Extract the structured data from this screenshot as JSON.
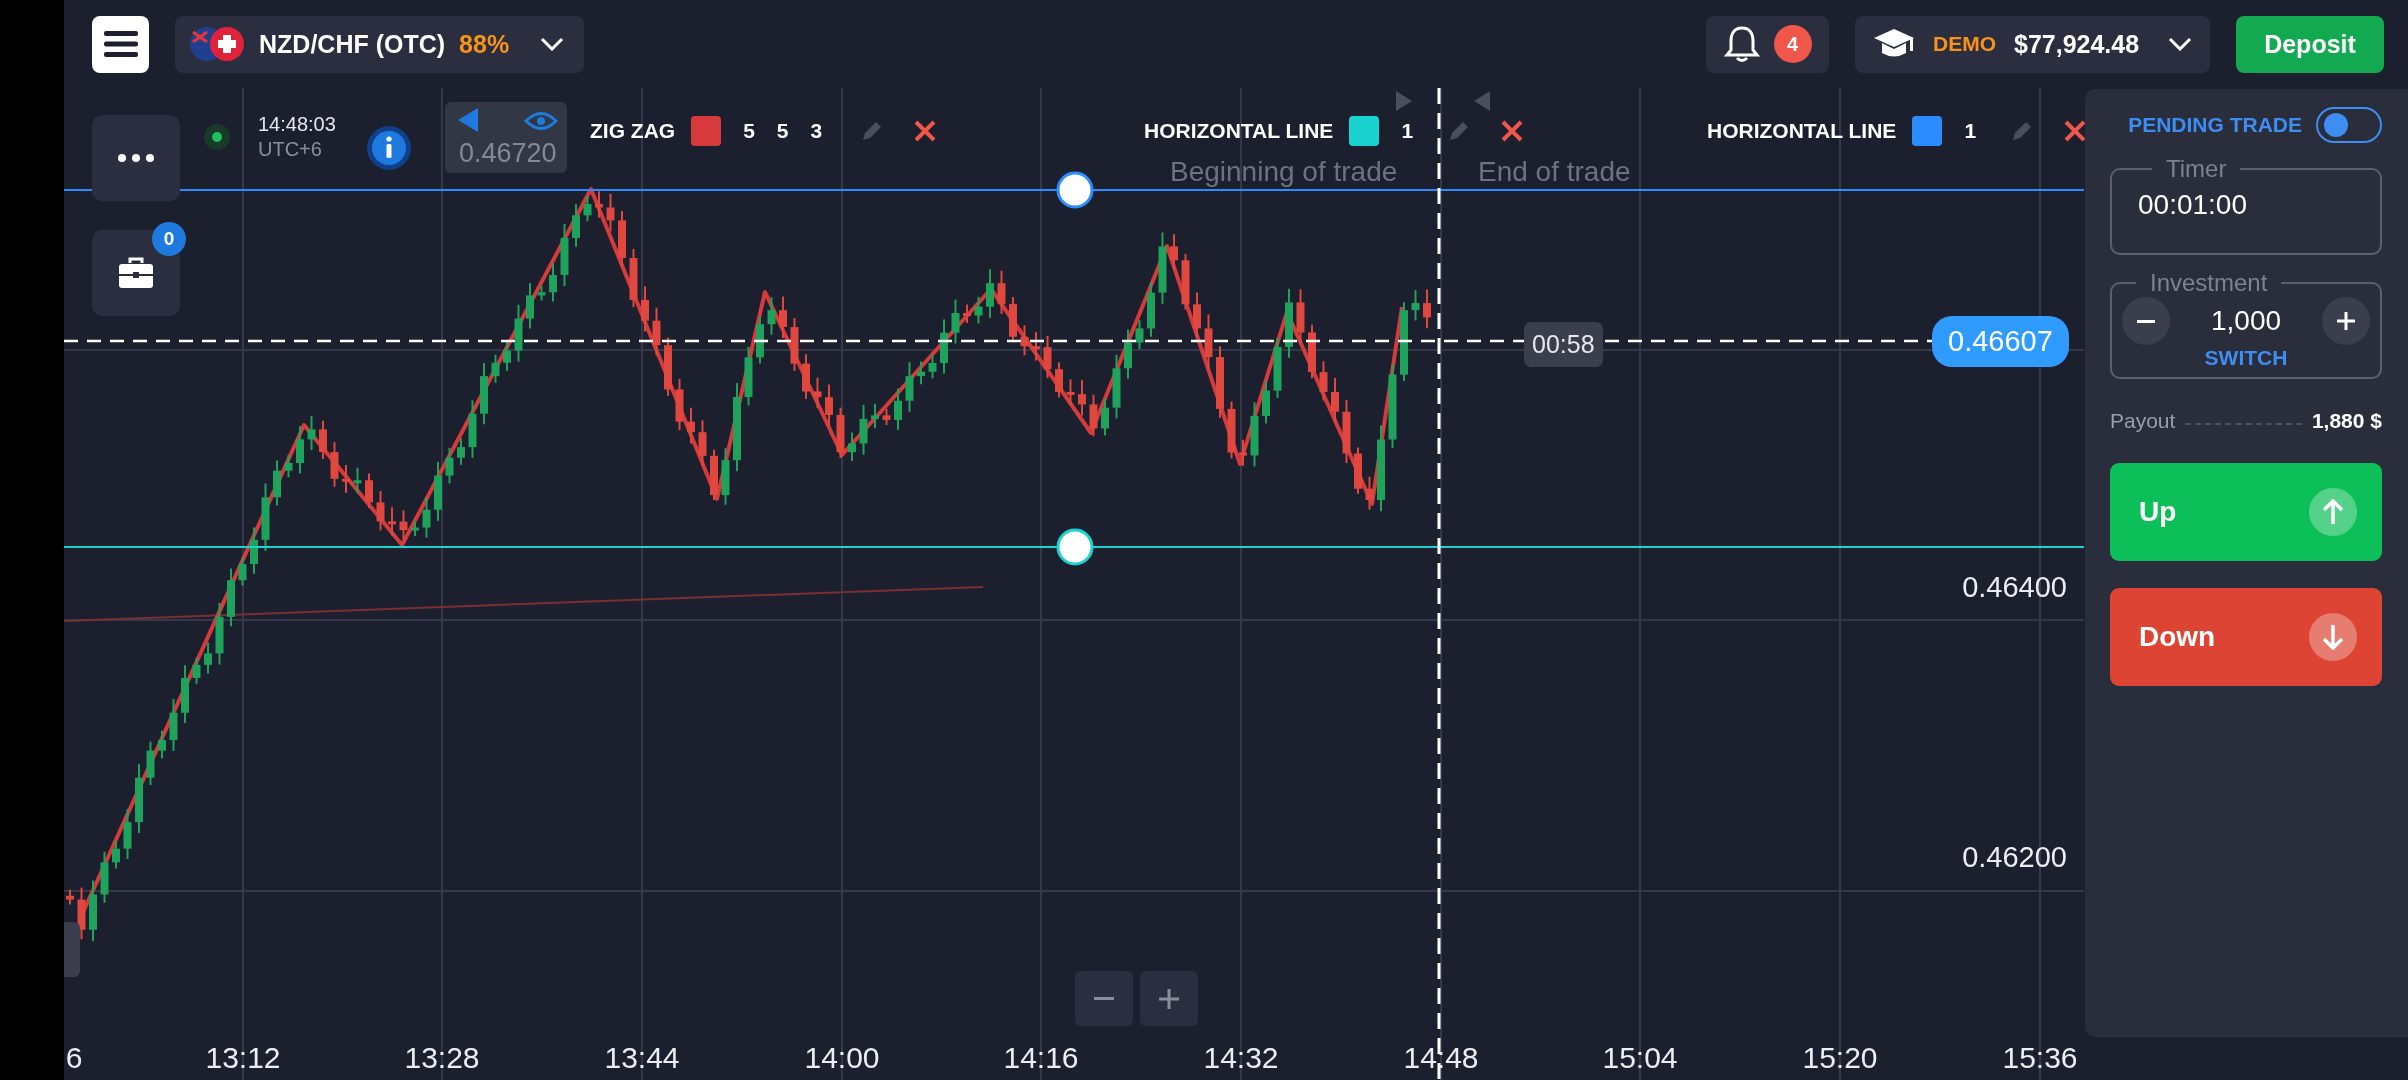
{
  "top_bar": {
    "asset": {
      "name": "NZD/CHF (OTC)",
      "payout": "88%"
    },
    "notifications": {
      "count": "4"
    },
    "account": {
      "type": "DEMO",
      "balance": "$77,924.48"
    },
    "deposit_button": "Deposit"
  },
  "side_buttons": [
    {
      "kind": "more"
    },
    {
      "kind": "portfolio",
      "badge": "0"
    }
  ],
  "chart": {
    "clock": {
      "time": "14:48:03",
      "timezone": "UTC+6"
    },
    "ghost_price": "0.46720",
    "indicators": [
      {
        "kind": "zigzag",
        "name": "ZIG ZAG",
        "color": "#d63a3a",
        "params": [
          "5",
          "5",
          "3"
        ]
      },
      {
        "kind": "hline",
        "name": "HORIZONTAL LINE",
        "color": "#19d3d0",
        "params": [
          "1"
        ]
      },
      {
        "kind": "hline",
        "name": "HORIZONTAL LINE",
        "color": "#2a8cff",
        "params": [
          "1"
        ]
      }
    ],
    "trade_markers": {
      "start": "Beginning of trade",
      "end": "End of trade"
    },
    "countdown": "00:58",
    "current_price": "0.46607",
    "price_axis": [
      "0.46400",
      "0.46200"
    ],
    "time_axis": [
      "6",
      "13:12",
      "13:28",
      "13:44",
      "14:00",
      "14:16",
      "14:32",
      "14:48",
      "15:04",
      "15:20",
      "15:36"
    ]
  },
  "trade_panel": {
    "pending_trade": {
      "label": "PENDING TRADE",
      "on": false
    },
    "timer": {
      "label": "Timer",
      "value": "00:01:00"
    },
    "investment": {
      "label": "Investment",
      "value": "1,000",
      "switch": "SWITCH"
    },
    "payout": {
      "label": "Payout",
      "value": "1,880 $"
    },
    "actions": [
      {
        "kind": "up",
        "label": "Up"
      },
      {
        "kind": "down",
        "label": "Down"
      }
    ]
  }
}
